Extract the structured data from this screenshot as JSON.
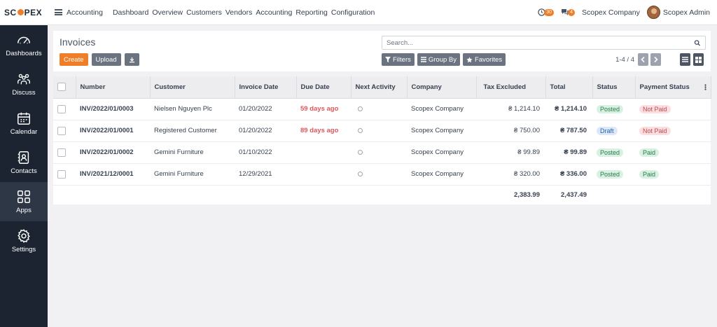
{
  "brand": {
    "logo_left": "SC",
    "logo_right": "PEX"
  },
  "topbar": {
    "app_name": "Accounting",
    "nav": [
      "Dashboard",
      "Overview",
      "Customers",
      "Vendors",
      "Accounting",
      "Reporting",
      "Configuration"
    ],
    "activity_count": "30",
    "message_count": "4",
    "company": "Scopex Company",
    "user": "Scopex Admin"
  },
  "sidebar": {
    "items": [
      {
        "label": "Dashboards",
        "icon": "gauge-icon"
      },
      {
        "label": "Discuss",
        "icon": "discuss-icon"
      },
      {
        "label": "Calendar",
        "icon": "calendar-icon"
      },
      {
        "label": "Contacts",
        "icon": "contacts-icon"
      },
      {
        "label": "Apps",
        "icon": "apps-grid-icon"
      },
      {
        "label": "Settings",
        "icon": "gear-icon"
      }
    ]
  },
  "control_panel": {
    "title": "Invoices",
    "create_label": "Create",
    "upload_label": "Upload",
    "search_placeholder": "Search...",
    "filters_label": "Filters",
    "group_by_label": "Group By",
    "favorites_label": "Favorites",
    "pager": "1-4 / 4"
  },
  "table": {
    "columns": [
      "Number",
      "Customer",
      "Invoice Date",
      "Due Date",
      "Next Activity",
      "Company",
      "Tax Excluded",
      "Total",
      "Status",
      "Payment Status"
    ],
    "rows": [
      {
        "number": "INV/2022/01/0003",
        "customer": "Nielsen Nguyen Plc",
        "invoice_date": "01/20/2022",
        "due_date": "59 days ago",
        "company": "Scopex Company",
        "tax_excluded": "₴ 1,214.10",
        "total": "₴ 1,214.10",
        "status": "Posted",
        "payment_status": "Not Paid"
      },
      {
        "number": "INV/2022/01/0001",
        "customer": "Registered Customer",
        "invoice_date": "01/20/2022",
        "due_date": "89 days ago",
        "company": "Scopex Company",
        "tax_excluded": "₴ 750.00",
        "total": "₴ 787.50",
        "status": "Draft",
        "payment_status": "Not Paid"
      },
      {
        "number": "INV/2022/01/0002",
        "customer": "Gemini Furniture",
        "invoice_date": "01/10/2022",
        "due_date": "",
        "company": "Scopex Company",
        "tax_excluded": "₴ 99.89",
        "total": "₴ 99.89",
        "status": "Posted",
        "payment_status": "Paid"
      },
      {
        "number": "INV/2021/12/0001",
        "customer": "Gemini Furniture",
        "invoice_date": "12/29/2021",
        "due_date": "",
        "company": "Scopex Company",
        "tax_excluded": "₴ 320.00",
        "total": "₴ 336.00",
        "status": "Posted",
        "payment_status": "Paid"
      }
    ],
    "totals": {
      "tax_excluded": "2,383.99",
      "total": "2,437.49"
    }
  },
  "colors": {
    "accent": "#f07d27",
    "sidebar_bg": "#1b2430",
    "overdue": "#e0555a"
  }
}
